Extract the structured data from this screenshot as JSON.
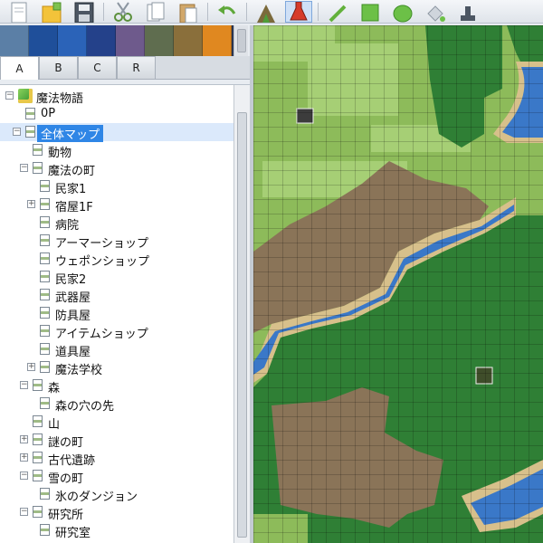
{
  "toolbar": {
    "icons": [
      "page-icon",
      "new-folder-icon",
      "save-icon",
      "cut-icon",
      "copy-icon",
      "paste-icon",
      "undo-icon",
      "map-mountain-icon",
      "event-flask-icon",
      "pencil-icon",
      "rectangle-icon",
      "ellipse-icon",
      "fill-bucket-icon",
      "stamp-icon"
    ]
  },
  "tileset_tabs": [
    "A",
    "B",
    "C",
    "R"
  ],
  "tree": {
    "items": [
      {
        "label": "魔法物語",
        "depth": 0,
        "expander": "−",
        "root": true
      },
      {
        "label": "0P",
        "depth": 1,
        "expander": ""
      },
      {
        "label": "全体マップ",
        "depth": 1,
        "expander": "−",
        "selected": true
      },
      {
        "label": "動物",
        "depth": 2,
        "expander": ""
      },
      {
        "label": "魔法の町",
        "depth": 2,
        "expander": "−"
      },
      {
        "label": "民家1",
        "depth": 3,
        "expander": ""
      },
      {
        "label": "宿屋1F",
        "depth": 3,
        "expander": "+"
      },
      {
        "label": "病院",
        "depth": 3,
        "expander": ""
      },
      {
        "label": "アーマーショップ",
        "depth": 3,
        "expander": ""
      },
      {
        "label": "ウェポンショップ",
        "depth": 3,
        "expander": ""
      },
      {
        "label": "民家2",
        "depth": 3,
        "expander": ""
      },
      {
        "label": "武器屋",
        "depth": 3,
        "expander": ""
      },
      {
        "label": "防具屋",
        "depth": 3,
        "expander": ""
      },
      {
        "label": "アイテムショップ",
        "depth": 3,
        "expander": ""
      },
      {
        "label": "道具屋",
        "depth": 3,
        "expander": ""
      },
      {
        "label": "魔法学校",
        "depth": 3,
        "expander": "+"
      },
      {
        "label": "森",
        "depth": 2,
        "expander": "−"
      },
      {
        "label": "森の穴の先",
        "depth": 3,
        "expander": ""
      },
      {
        "label": "山",
        "depth": 2,
        "expander": ""
      },
      {
        "label": "謎の町",
        "depth": 2,
        "expander": "+"
      },
      {
        "label": "古代遺跡",
        "depth": 2,
        "expander": "+"
      },
      {
        "label": "雪の町",
        "depth": 2,
        "expander": "−"
      },
      {
        "label": "氷のダンジョン",
        "depth": 3,
        "expander": ""
      },
      {
        "label": "研究所",
        "depth": 2,
        "expander": "−"
      },
      {
        "label": "研究室",
        "depth": 3,
        "expander": ""
      }
    ]
  },
  "colors": {
    "selection": "#2f86e6",
    "water": "#3a78c8",
    "forest": "#2f7f35",
    "grass": "#8dbb5a",
    "mountain": "#8a7458"
  }
}
